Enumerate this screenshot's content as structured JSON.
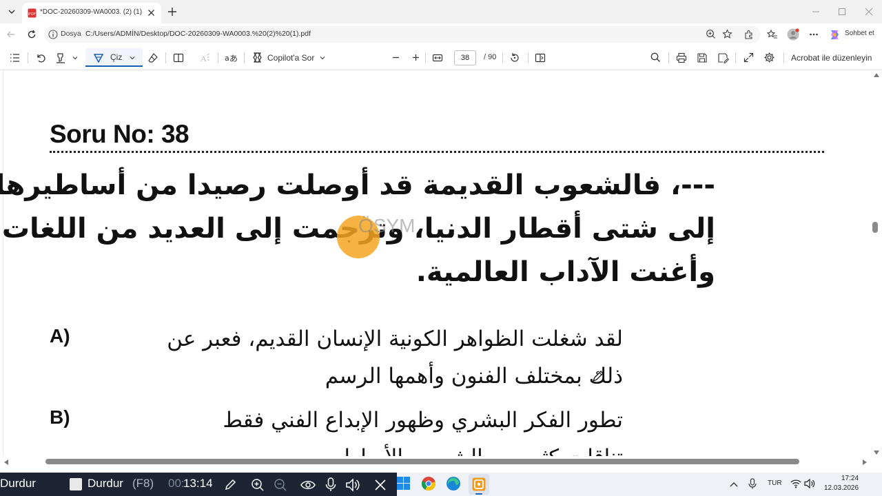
{
  "browser": {
    "tab_title": "*DOC-20260309-WA0003. (2) (1).pdf",
    "url_site": "Dosya",
    "url": "C:/Users/ADMİN/Desktop/DOC-20260309-WA0003.%20(2)%20(1).pdf",
    "chat_label": "Sohbet et"
  },
  "pdf_toolbar": {
    "draw_label": "Çiz",
    "copilot_label": "Copilot'a Sor",
    "page_current": "38",
    "page_total": "/ 90",
    "acrobat_label": "Acrobat ile düzenleyin"
  },
  "document": {
    "question_title": "Soru No: 38",
    "watermark": "ÖSYM",
    "question_lines": [
      "---، فالشعوب القديمة قد أوصلت رصيدا من أساطيرها",
      "إلى شتى أقطار الدنيا، وترجمت إلى العديد من اللغات",
      "وأغنت الآداب العالمية."
    ],
    "options": [
      {
        "letter": "A)",
        "lines": [
          "لقد شغلت الظواهر الكونية الإنسان القديم، فعبر عن",
          "ذلك بمختلف الفنون وأهمها الرسم"
        ]
      },
      {
        "letter": "B)",
        "lines": [
          "تطور الفكر البشري وظهور الإبداع الفني فقط",
          "تناقلت كثير من الشعوب الأساطير"
        ]
      }
    ]
  },
  "recorder": {
    "stop_label_1": "Durdur",
    "stop_label_2": "Durdur",
    "stop_key": "(F8)",
    "time_dim": "00:",
    "time": "13:14"
  },
  "taskbar": {
    "language": "TUR",
    "time": "17:24",
    "date": "12.03.2026"
  }
}
